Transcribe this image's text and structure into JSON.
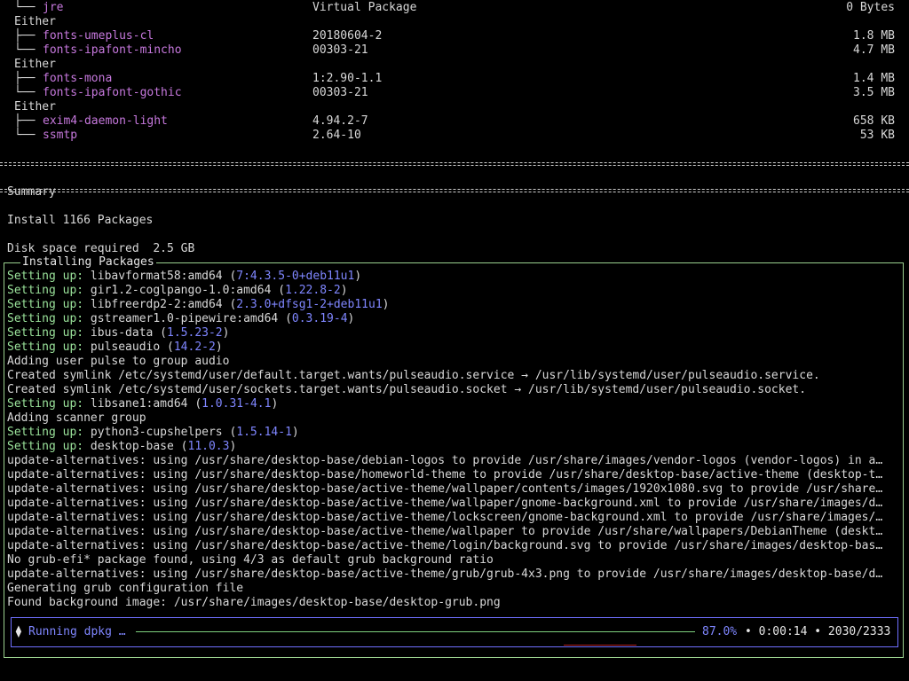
{
  "top_packages": [
    {
      "tree": "└──",
      "name": "jre",
      "version": "Virtual Package",
      "size": "0 Bytes"
    },
    {
      "either": "Either"
    },
    {
      "tree": "├──",
      "name": "fonts-umeplus-cl",
      "version": "20180604-2",
      "size": "1.8 MB"
    },
    {
      "tree": "└──",
      "name": "fonts-ipafont-mincho",
      "version": "00303-21",
      "size": "4.7 MB"
    },
    {
      "either": "Either"
    },
    {
      "tree": "├──",
      "name": "fonts-mona",
      "version": "1:2.90-1.1",
      "size": "1.4 MB"
    },
    {
      "tree": "└──",
      "name": "fonts-ipafont-gothic",
      "version": "00303-21",
      "size": "3.5 MB"
    },
    {
      "either": "Either"
    },
    {
      "tree": "├──",
      "name": "exim4-daemon-light",
      "version": "4.94.2-7",
      "size": "658 KB"
    },
    {
      "tree": "└──",
      "name": "ssmtp",
      "version": "2.64-10",
      "size": "53 KB"
    }
  ],
  "summary": {
    "heading": "Summary",
    "install": "Install 1166 Packages",
    "disk": "Disk space required  2.5 GB"
  },
  "panel_title": "Installing Packages",
  "log": [
    {
      "prefix": "Setting up:",
      "text": " libavformat58:amd64 (",
      "ver": "7:4.3.5-0+deb11u1",
      "suffix": ")"
    },
    {
      "prefix": "Setting up:",
      "text": " gir1.2-coglpango-1.0:amd64 (",
      "ver": "1.22.8-2",
      "suffix": ")"
    },
    {
      "prefix": "Setting up:",
      "text": " libfreerdp2-2:amd64 (",
      "ver": "2.3.0+dfsg1-2+deb11u1",
      "suffix": ")"
    },
    {
      "prefix": "Setting up:",
      "text": " gstreamer1.0-pipewire:amd64 (",
      "ver": "0.3.19-4",
      "suffix": ")"
    },
    {
      "prefix": "Setting up:",
      "text": " ibus-data (",
      "ver": "1.5.23-2",
      "suffix": ")"
    },
    {
      "prefix": "Setting up:",
      "text": " pulseaudio (",
      "ver": "14.2-2",
      "suffix": ")"
    },
    {
      "plain": "Adding user pulse to group audio"
    },
    {
      "plain": "Created symlink /etc/systemd/user/default.target.wants/pulseaudio.service → /usr/lib/systemd/user/pulseaudio.service."
    },
    {
      "plain": "Created symlink /etc/systemd/user/sockets.target.wants/pulseaudio.socket → /usr/lib/systemd/user/pulseaudio.socket."
    },
    {
      "prefix": "Setting up:",
      "text": " libsane1:amd64 (",
      "ver": "1.0.31-4.1",
      "suffix": ")"
    },
    {
      "plain": "Adding scanner group"
    },
    {
      "prefix": "Setting up:",
      "text": " python3-cupshelpers (",
      "ver": "1.5.14-1",
      "suffix": ")"
    },
    {
      "prefix": "Setting up:",
      "text": " desktop-base (",
      "ver": "11.0.3",
      "suffix": ")"
    },
    {
      "plain": "update-alternatives: using /usr/share/desktop-base/debian-logos to provide /usr/share/images/vendor-logos (vendor-logos) in a…"
    },
    {
      "plain": "update-alternatives: using /usr/share/desktop-base/homeworld-theme to provide /usr/share/desktop-base/active-theme (desktop-t…"
    },
    {
      "plain": "update-alternatives: using /usr/share/desktop-base/active-theme/wallpaper/contents/images/1920x1080.svg to provide /usr/share…"
    },
    {
      "plain": "update-alternatives: using /usr/share/desktop-base/active-theme/wallpaper/gnome-background.xml to provide /usr/share/images/d…"
    },
    {
      "plain": "update-alternatives: using /usr/share/desktop-base/active-theme/lockscreen/gnome-background.xml to provide /usr/share/images/…"
    },
    {
      "plain": "update-alternatives: using /usr/share/desktop-base/active-theme/wallpaper to provide /usr/share/wallpapers/DebianTheme (deskt…"
    },
    {
      "plain": "update-alternatives: using /usr/share/desktop-base/active-theme/login/background.svg to provide /usr/share/images/desktop-bas…"
    },
    {
      "plain": "No grub-efi* package found, using 4/3 as default grub background ratio"
    },
    {
      "plain": "update-alternatives: using /usr/share/desktop-base/active-theme/grub/grub-4x3.png to provide /usr/share/images/desktop-base/d…"
    },
    {
      "plain": "Generating grub configuration file"
    },
    {
      "plain": "Found background image: /usr/share/images/desktop-base/desktop-grub.png"
    }
  ],
  "progress": {
    "spinner": "⧫",
    "label": "Running dpkg …",
    "percent_text": "87.0%",
    "percent": 87.0,
    "stats": "• 0:00:14 • 2030/2333"
  }
}
